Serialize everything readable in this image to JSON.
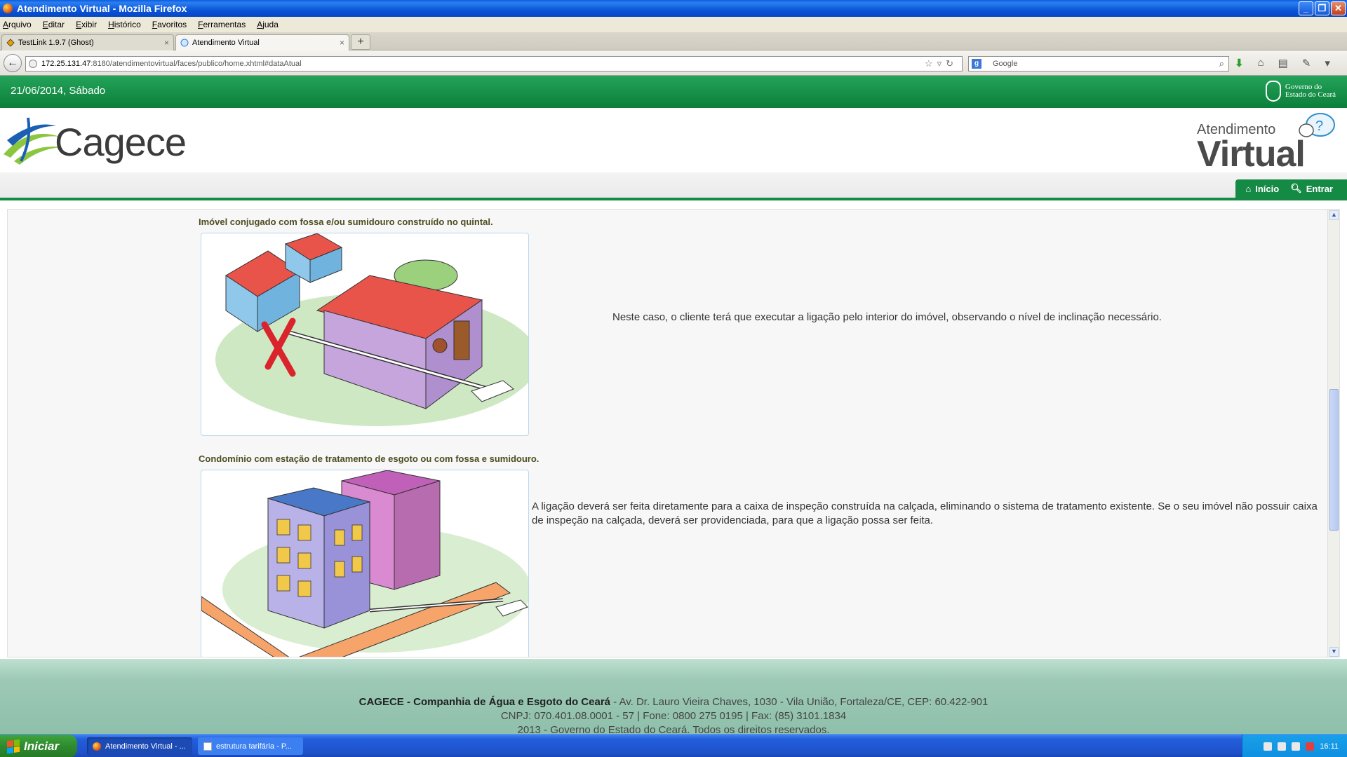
{
  "window": {
    "title": "Atendimento Virtual - Mozilla Firefox",
    "buttons": {
      "minimize": "_",
      "restore": "❐",
      "close": "✕"
    }
  },
  "menubar": [
    "Arquivo",
    "Editar",
    "Exibir",
    "Histórico",
    "Favoritos",
    "Ferramentas",
    "Ajuda"
  ],
  "tabs": [
    {
      "label": "TestLink 1.9.7 (Ghost)",
      "close": "×"
    },
    {
      "label": "Atendimento Virtual",
      "close": "×"
    }
  ],
  "newtab": "+",
  "navbar": {
    "back": "←",
    "url_host": "172.25.131.47",
    "url_path": ":8180/atendimentovirtual/faces/publico/home.xhtml#dataAtual",
    "url_icons": "☆▿↻",
    "search_engine": "g",
    "search_placeholder": "Google",
    "search_icon": "⌕",
    "icons": [
      "download-icon",
      "home-icon",
      "library-icon",
      "addons-icon",
      "menu-icon"
    ]
  },
  "site": {
    "date": "21/06/2014, Sábado",
    "gov_line1": "Governo do",
    "gov_line2": "Estado do Ceará",
    "logo_text": "Cagece",
    "av_line1": "Atendimento",
    "av_line2": "Virtual",
    "nav": {
      "home": "Início",
      "login": "Entrar"
    }
  },
  "sections": [
    {
      "title": "Imóvel conjugado com fossa e/ou sumidouro construído no quintal.",
      "description": "Neste caso, o cliente terá que executar a ligação pelo interior do imóvel, observando o nível de inclinação necessário."
    },
    {
      "title": "Condomínio com estação de tratamento de esgoto ou com fossa e sumidouro.",
      "description": "A ligação deverá ser feita diretamente para a caixa de inspeção construída na calçada, eliminando o sistema de tratamento existente. Se o seu imóvel não possuir caixa de inspeção na calçada, deverá ser providenciada, para que a ligação possa ser feita."
    }
  ],
  "footer": {
    "company": "CAGECE - Companhia de Água e Esgoto do Ceará",
    "address": " - Av. Dr. Lauro Vieira Chaves, 1030 - Vila União, Fortaleza/CE, CEP: 60.422-901",
    "line2": "CNPJ: 070.401.08.0001 - 57 | Fone: 0800 275 0195 | Fax: (85) 3101.1834",
    "line3": "2013 - Governo do Estado do Ceará. Todos os direitos reservados."
  },
  "taskbar": {
    "start": "Iniciar",
    "tasks": [
      "Atendimento Virtual - ...",
      "estrutura tarifária - P..."
    ],
    "clock": "16:11"
  },
  "colors": {
    "brand_green": "#148a45",
    "xp_blue": "#245edb"
  }
}
